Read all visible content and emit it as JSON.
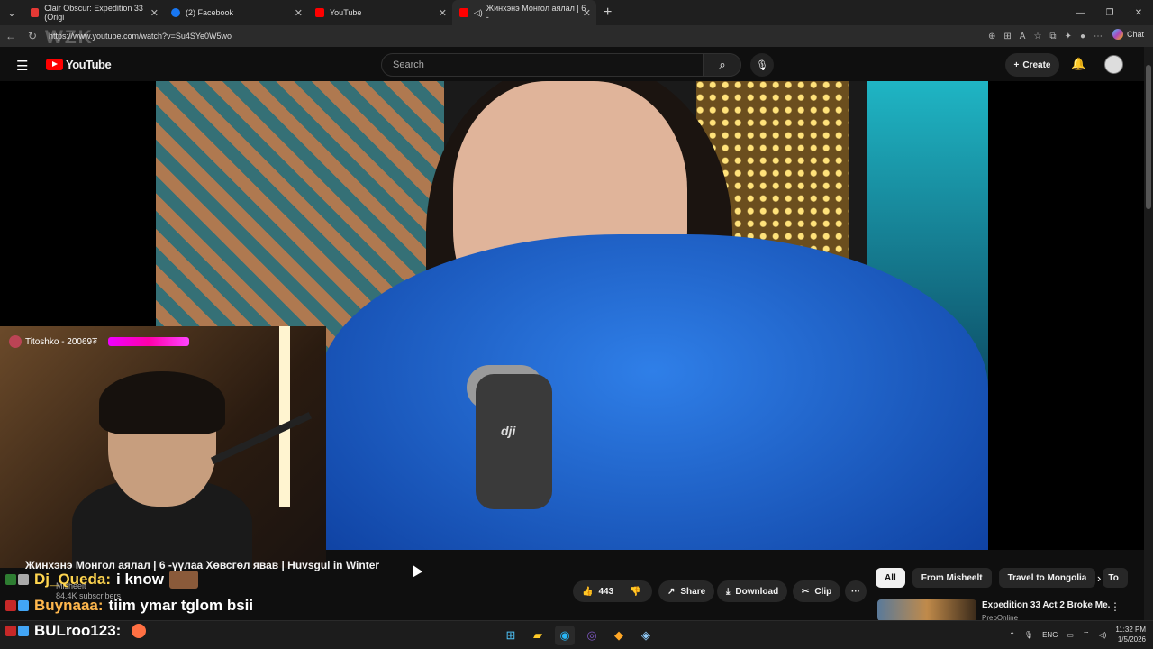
{
  "browser": {
    "tabs": [
      {
        "title": "Clair Obscur: Expedition 33 (Origi",
        "color": "#e53935",
        "active": false
      },
      {
        "title": "(2) Facebook",
        "color": "#1877f2",
        "active": false
      },
      {
        "title": "YouTube",
        "color": "#ff0000",
        "active": false
      },
      {
        "title": "Жинхэнэ Монгол аялал | 6 -",
        "color": "#ff0000",
        "active": true
      }
    ],
    "new_tab": "+",
    "url": "https://www.youtube.com/watch?v=Su4SYe0W5wo",
    "chat_label": "Chat",
    "icons": [
      "back-icon",
      "refresh-icon",
      "translate-icon",
      "apps-icon",
      "read-aloud-icon",
      "favorite-icon",
      "extensions-icon",
      "profile-icon",
      "more-icon"
    ]
  },
  "youtube": {
    "logo_text": "YouTube",
    "search_placeholder": "Search",
    "create_label": "Create",
    "colors": {
      "accent": "#ff0000",
      "background": "#0f0f0f"
    }
  },
  "video": {
    "title": "Жинхэнэ Монгол аялал | 6 -үүлаа Хөвсгөл явав | Huvsgul in Winter",
    "overlay_text": "WZK",
    "mic_brand": "dji",
    "channel_name": "Misheelt",
    "subscribers": "84.4K subscribers",
    "likes": "443",
    "share_label": "Share",
    "download_label": "Download",
    "clip_label": "Clip",
    "more_label": "···"
  },
  "stream": {
    "cam_label": "Titoshko - 20069₮",
    "chat": [
      {
        "user": "Dj_Queda:",
        "message": "i know"
      },
      {
        "user": "Buynaaa:",
        "message": "tiim ymar tglom bsii"
      },
      {
        "user": "BULroo123:",
        "message": ""
      }
    ]
  },
  "recommendations": {
    "chips": [
      "All",
      "From Misheelt",
      "Travel to Mongolia",
      "To"
    ],
    "first_video_title": "Expedition 33 Act 2 Broke Me.",
    "first_video_channel": "PrepOnline"
  },
  "taskbar": {
    "lang": "ENG",
    "time": "11:32 PM",
    "date": "1/5/2026"
  }
}
